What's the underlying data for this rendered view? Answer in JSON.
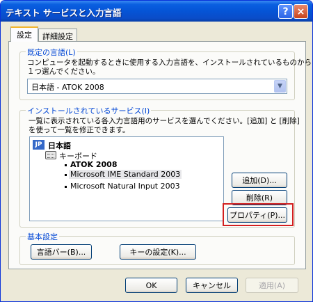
{
  "window": {
    "title": "テキスト サービスと入力言語",
    "help_label": "?",
    "close_label": "×"
  },
  "tabs": [
    {
      "label": "設定",
      "active": true
    },
    {
      "label": "詳細設定",
      "active": false
    }
  ],
  "default_language": {
    "title": "既定の言語(L)",
    "description_line1": "コンピュータを起動するときに使用する入力言語を、インストールされているものから",
    "description_line2": "１つ選んでください。",
    "selected_value": "日本語 - ATOK 2008"
  },
  "installed_services": {
    "title": "インストールされているサービス(I)",
    "description_line1": "一覧に表示されている各入力言語用のサービスを選んでください。[追加] と [削除]",
    "description_line2": "を使って一覧を修正できます。",
    "language_icon": "JP",
    "language": "日本語",
    "category": "キーボード",
    "items": [
      {
        "label": "ATOK 2008",
        "bold": true
      },
      {
        "label": "Microsoft IME Standard 2003",
        "selected": true
      },
      {
        "label": "Microsoft Natural Input 2003"
      }
    ],
    "add_label": "追加(D)...",
    "remove_label": "削除(R)",
    "properties_label": "プロパティ(P)..."
  },
  "basic_settings": {
    "title": "基本設定",
    "language_bar_label": "言語バー(B)...",
    "key_settings_label": "キーの設定(K)..."
  },
  "footer": {
    "ok_label": "OK",
    "cancel_label": "キャンセル",
    "apply_label": "適用(A)"
  },
  "colors": {
    "titlebar": "#0554d6",
    "group_title": "#0046d5",
    "highlight": "#d21f1f"
  }
}
